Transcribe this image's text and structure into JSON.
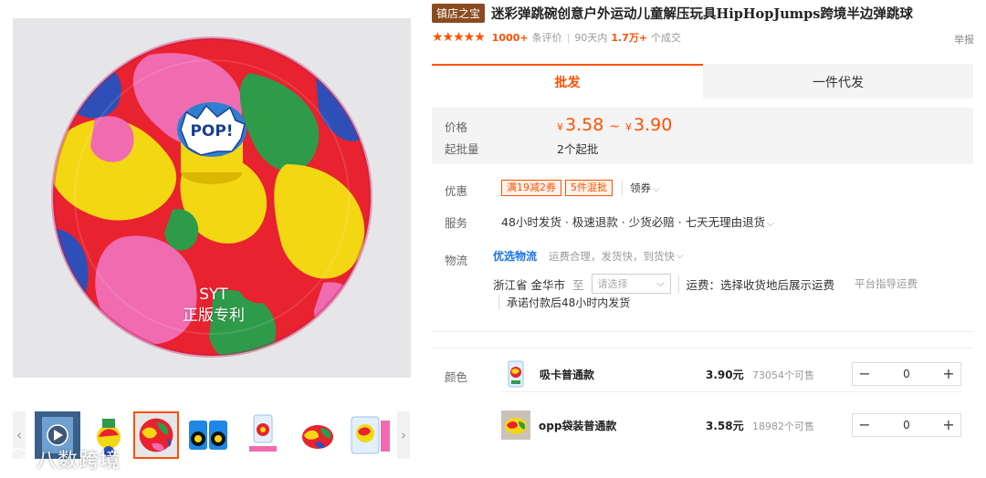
{
  "gallery": {
    "main_caption_line1": "SYT",
    "main_caption_line2": "正版专利",
    "main_badge_text": "POP!",
    "thumb_count": 7,
    "selected_thumb": 3
  },
  "watermark": {
    "text": "八数跨境"
  },
  "shop_badge": "镇店之宝",
  "product": {
    "title": "迷彩弹跳碗创意户外运动儿童解压玩具HipHopJumps跨境半边弹跳球",
    "rating_stars": 5,
    "review_count": "1000+",
    "review_label": "条评价",
    "period_label": "90天内",
    "deals_count": "1.7万+",
    "deals_label": "个成交",
    "report_label": "举报"
  },
  "mode_tabs": [
    {
      "label": "批发",
      "active": true
    },
    {
      "label": "一件代发",
      "active": false
    }
  ],
  "price": {
    "label": "价格",
    "currency": "¥",
    "min": "3.58",
    "separator": "~",
    "max": "3.90",
    "moq_label": "起批量",
    "moq_value": "2个起批"
  },
  "discount": {
    "label": "优惠",
    "tags": [
      "满19减2券",
      "5件混批"
    ],
    "claim_label": "领券"
  },
  "service": {
    "label": "服务",
    "text": "48小时发货 · 极速退款 · 少货必赔 · 七天无理由退货"
  },
  "logistics": {
    "label": "物流",
    "highlight": "优选物流",
    "note": "运费合理，发货快，到货快",
    "origin": "浙江省 金华市",
    "to_label": "至",
    "region_placeholder": "请选择",
    "fee_text": "运费：选择收货地后展示运费",
    "guide_link": "平台指导运费",
    "promise": "承诺付款后48小时内发货"
  },
  "color": {
    "label": "颜色",
    "options": [
      {
        "name": "吸卡普通款",
        "price": "3.90元",
        "stock": "73054个可售",
        "qty": "0"
      },
      {
        "name": "opp袋装普通款",
        "price": "3.58元",
        "stock": "18982个可售",
        "qty": "0"
      }
    ]
  },
  "colors": {
    "accent": "#ff5000",
    "badge": "#8a4b20",
    "logistics_blue": "#1a73e8"
  }
}
